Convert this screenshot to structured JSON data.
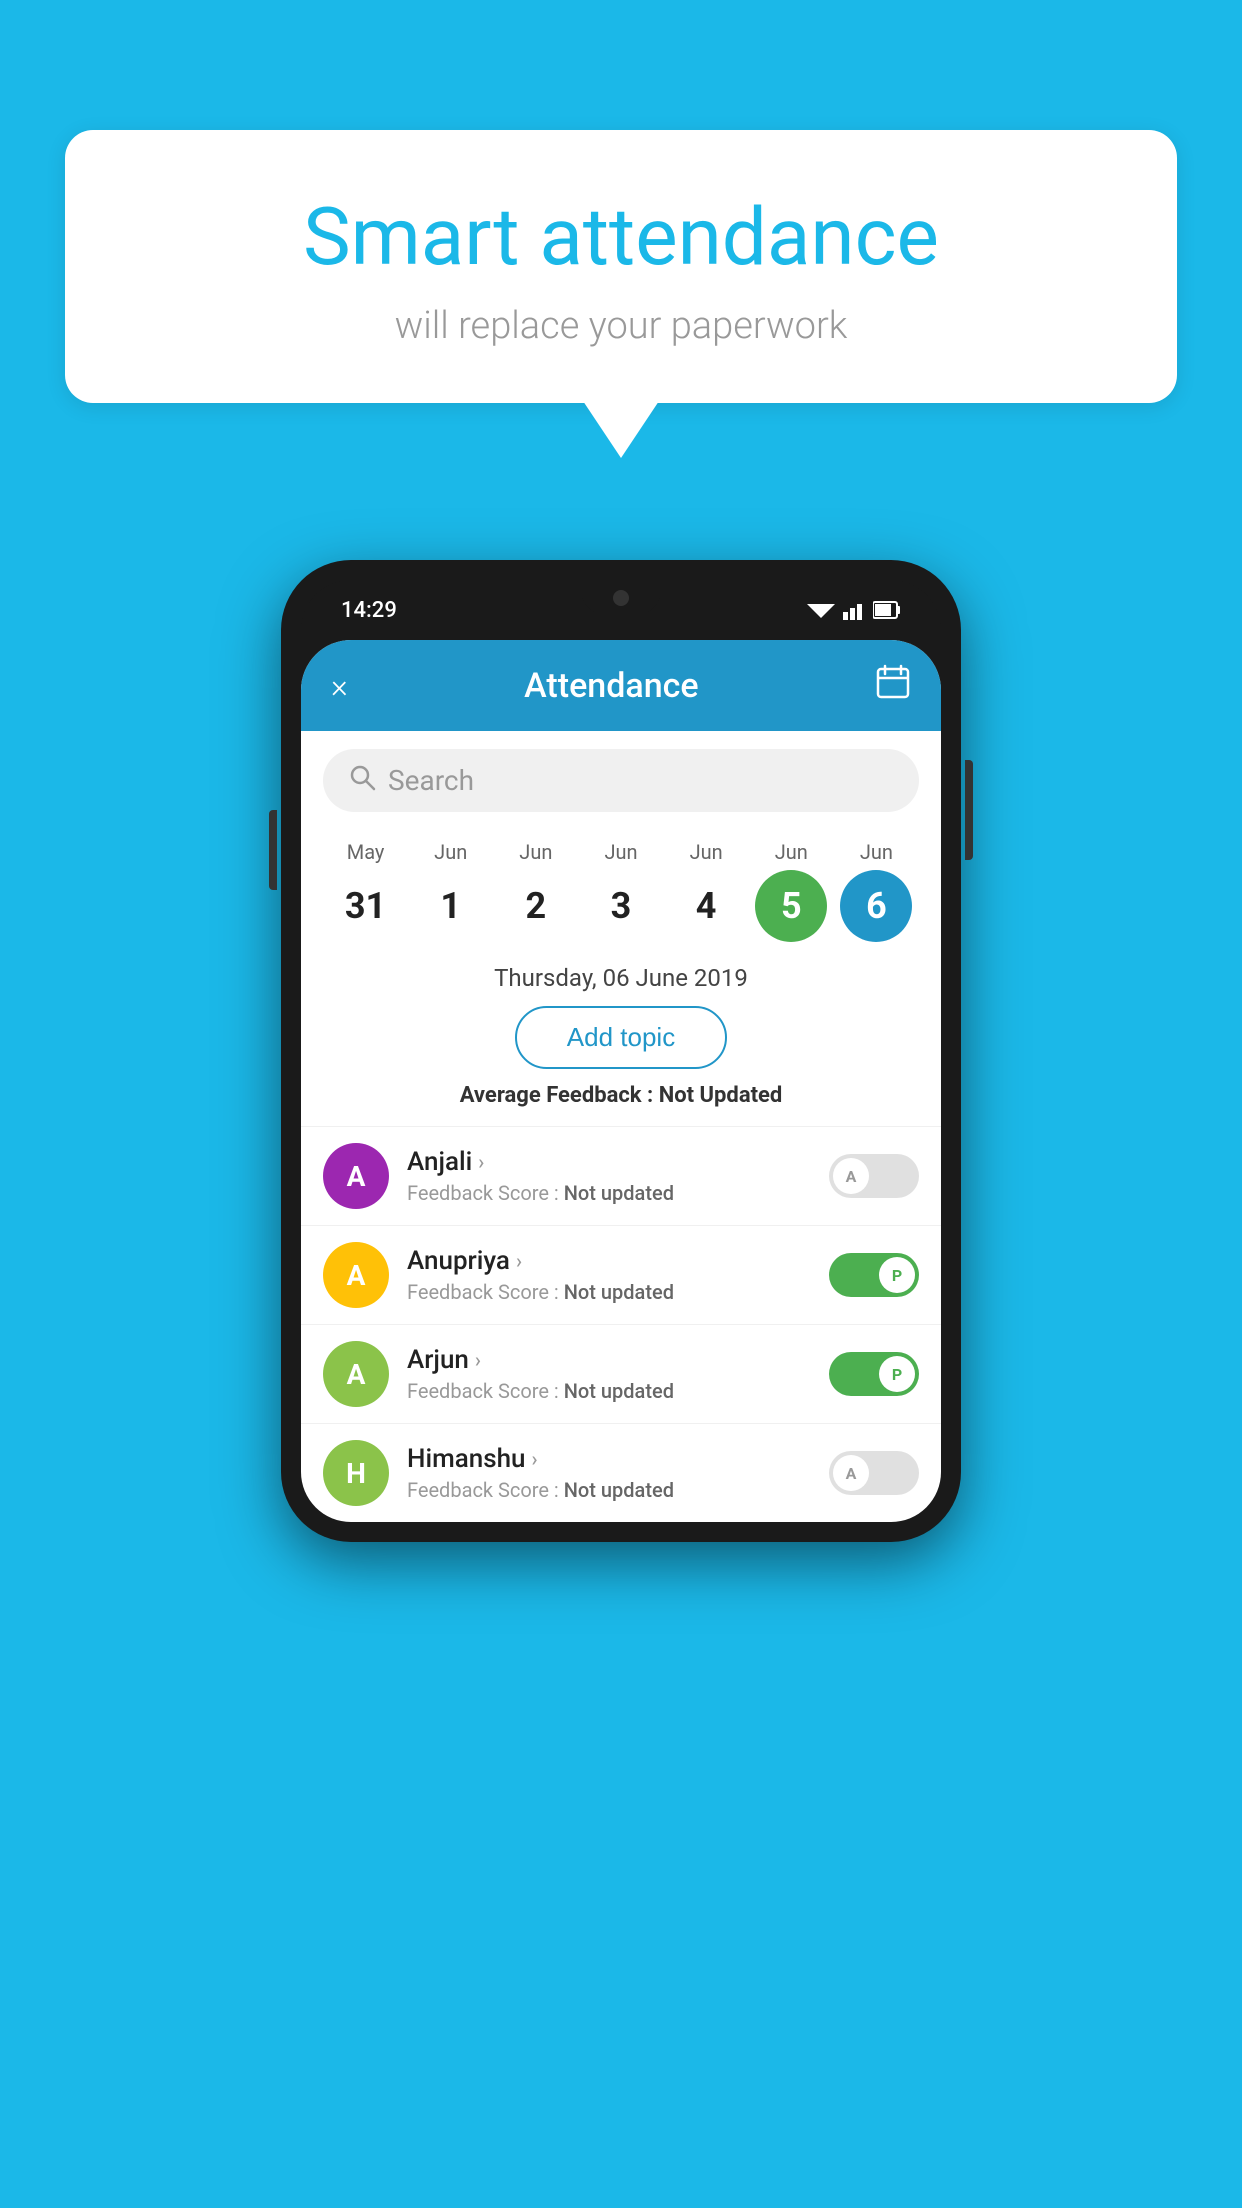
{
  "page": {
    "background_color": "#1BB8E8"
  },
  "speech_bubble": {
    "title": "Smart attendance",
    "subtitle": "will replace your paperwork"
  },
  "phone": {
    "status_bar": {
      "time": "14:29",
      "icons": "▼◄▌"
    },
    "header": {
      "title": "Attendance",
      "close_label": "×",
      "calendar_icon": "calendar-icon"
    },
    "search": {
      "placeholder": "Search"
    },
    "dates": [
      {
        "month": "May",
        "day": "31",
        "state": "normal"
      },
      {
        "month": "Jun",
        "day": "1",
        "state": "normal"
      },
      {
        "month": "Jun",
        "day": "2",
        "state": "normal"
      },
      {
        "month": "Jun",
        "day": "3",
        "state": "normal"
      },
      {
        "month": "Jun",
        "day": "4",
        "state": "normal"
      },
      {
        "month": "Jun",
        "day": "5",
        "state": "today"
      },
      {
        "month": "Jun",
        "day": "6",
        "state": "selected"
      }
    ],
    "selected_date_label": "Thursday, 06 June 2019",
    "add_topic_button": "Add topic",
    "avg_feedback_label": "Average Feedback : ",
    "avg_feedback_value": "Not Updated",
    "students": [
      {
        "name": "Anjali",
        "avatar_letter": "A",
        "avatar_color": "#9C27B0",
        "feedback_label": "Feedback Score : ",
        "feedback_value": "Not updated",
        "attendance": "absent",
        "toggle_letter": "A"
      },
      {
        "name": "Anupriya",
        "avatar_letter": "A",
        "avatar_color": "#FFC107",
        "feedback_label": "Feedback Score : ",
        "feedback_value": "Not updated",
        "attendance": "present",
        "toggle_letter": "P"
      },
      {
        "name": "Arjun",
        "avatar_letter": "A",
        "avatar_color": "#8BC34A",
        "feedback_label": "Feedback Score : ",
        "feedback_value": "Not updated",
        "attendance": "present",
        "toggle_letter": "P"
      },
      {
        "name": "Himanshu",
        "avatar_letter": "H",
        "avatar_color": "#8BC34A",
        "feedback_label": "Feedback Score : ",
        "feedback_value": "Not updated",
        "attendance": "absent",
        "toggle_letter": "A"
      }
    ]
  }
}
